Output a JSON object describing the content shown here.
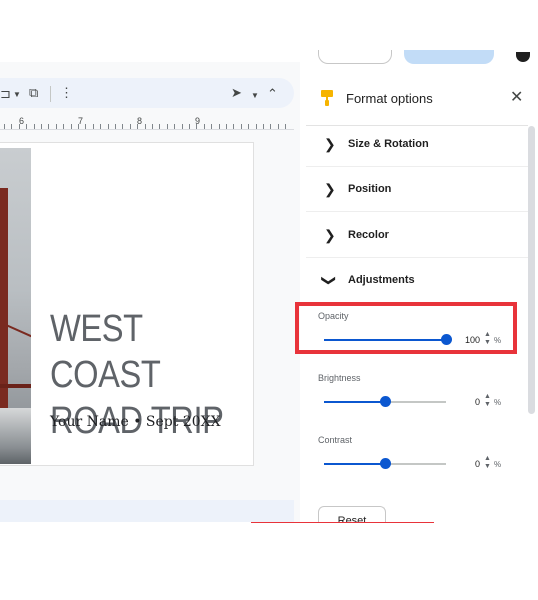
{
  "panel": {
    "title": "Format options",
    "close_icon": "close-icon",
    "sections": [
      {
        "label": "Size & Rotation",
        "expanded": false
      },
      {
        "label": "Position",
        "expanded": false
      },
      {
        "label": "Recolor",
        "expanded": false
      },
      {
        "label": "Adjustments",
        "expanded": true
      }
    ],
    "adjustments": {
      "opacity": {
        "label": "Opacity",
        "value": "100",
        "unit": "%",
        "fraction": 1.0
      },
      "brightness": {
        "label": "Brightness",
        "value": "0",
        "unit": "%",
        "fraction": 0.5
      },
      "contrast": {
        "label": "Contrast",
        "value": "0",
        "unit": "%",
        "fraction": 0.5
      }
    },
    "reset_label": "Reset"
  },
  "ruler": {
    "numbers": [
      "6",
      "7",
      "8",
      "9"
    ]
  },
  "slide": {
    "title_line1": "WEST COAST",
    "title_line2": "ROAD TRIP",
    "subtitle": "Your Name • Sept 20XX"
  },
  "colors": {
    "accent": "#0b57d0",
    "highlight": "#e8333a",
    "toolbar_bg": "#edf2fa"
  }
}
